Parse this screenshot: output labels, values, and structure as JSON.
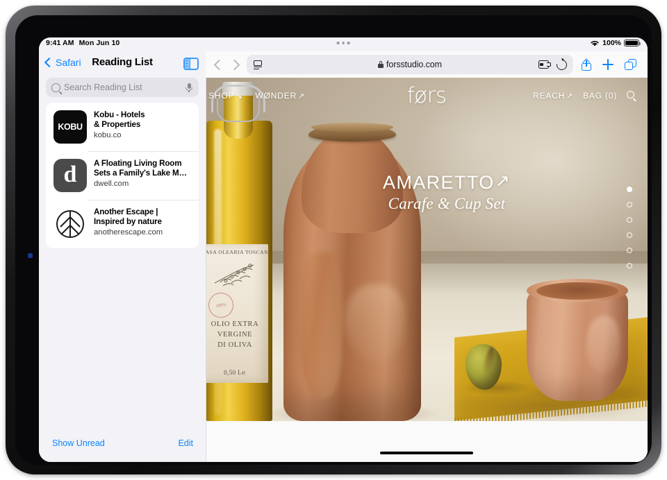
{
  "status_bar": {
    "time": "9:41 AM",
    "date": "Mon Jun 10",
    "wifi_icon": "wifi-icon",
    "battery_percent": "100%",
    "battery_icon": "battery-full-icon"
  },
  "sidebar": {
    "back_label": "Safari",
    "back_icon": "chevron-left-icon",
    "title": "Reading List",
    "toggle_icon": "sidebar-toggle-icon",
    "search": {
      "placeholder": "Search Reading List",
      "search_icon": "search-icon",
      "dictation_icon": "microphone-icon"
    },
    "items": [
      {
        "title": "Kobu - Hotels\n& Properties",
        "title_line1": "Kobu - Hotels",
        "title_line2": "& Properties",
        "url": "kobu.co",
        "thumb_text": "KOBU",
        "thumb_name": "kobu-favicon"
      },
      {
        "title_line1": "A Floating Living Room",
        "title_line2": "Sets a Family's Lake M…",
        "url": "dwell.com",
        "thumb_text": "d",
        "thumb_name": "dwell-favicon"
      },
      {
        "title_line1": "Another Escape |",
        "title_line2": "Inspired by nature",
        "url": "anotherescape.com",
        "thumb_text": "",
        "thumb_name": "another-escape-leaf-favicon"
      }
    ],
    "footer": {
      "show_unread_label": "Show Unread",
      "edit_label": "Edit"
    }
  },
  "browser": {
    "back_icon": "chevron-left-icon",
    "forward_icon": "chevron-right-icon",
    "reader_icon": "reader-view-icon",
    "lock_icon": "lock-icon",
    "url": "forsstudio.com",
    "extensions_icon": "extensions-puzzle-icon",
    "reload_icon": "reload-icon",
    "share_icon": "share-icon",
    "new_tab_icon": "plus-icon",
    "tabs_icon": "tab-overview-icon",
    "multitask_handle": "multitasking-dots"
  },
  "webpage": {
    "brand": "førs",
    "nav_left": [
      {
        "label": "SHOP",
        "arrow": "↘",
        "name": "nav-shop"
      },
      {
        "label": "WØNDER",
        "arrow": "↗",
        "name": "nav-wonder"
      }
    ],
    "nav_right": [
      {
        "label": "REACH",
        "arrow": "↗",
        "name": "nav-reach"
      },
      {
        "label": "BAG (0)",
        "arrow": "",
        "name": "nav-bag"
      }
    ],
    "search_icon": "search-icon",
    "hero": {
      "title": "AMARETTO",
      "title_arrow": "↗",
      "subtitle": "Carafe & Cup Set"
    },
    "carousel": {
      "total_dots": 6,
      "active_index": 0
    },
    "bottle_label": {
      "top": "CASA OLEARIA TOSCANA",
      "stamp": "100%",
      "lines": "OLIO EXTRA\nVERGINE\nDI OLIVA",
      "line1": "OLIO EXTRA",
      "line2": "VERGINE",
      "line3": "DI OLIVA",
      "volume": "0,50 L℮"
    }
  },
  "colors": {
    "accent_blue": "#0a84ff",
    "sidebar_bg": "#f2f2f7",
    "toolbar_bg": "#fafafa",
    "wall": "#bfb29c",
    "terracotta": "#c0855f",
    "cloth_yellow": "#cfa21b"
  }
}
